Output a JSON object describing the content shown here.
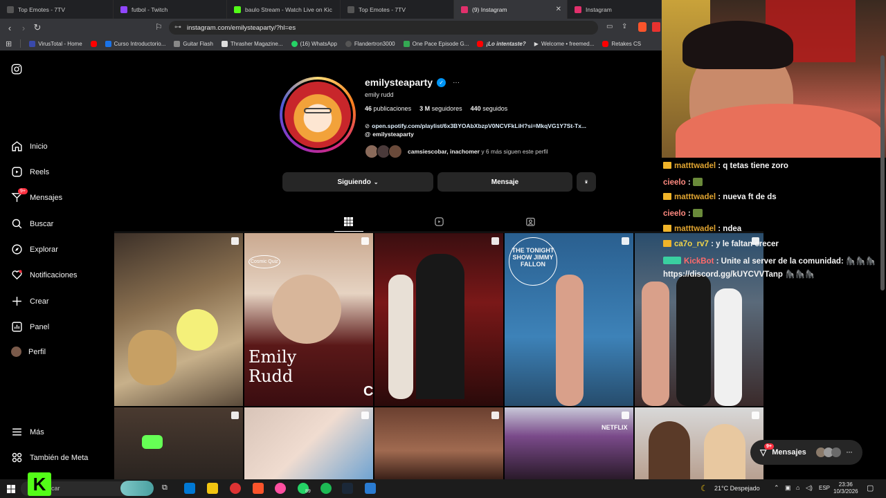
{
  "tabs": [
    {
      "label": "Top Emotes - 7TV",
      "color": "#29b6f6"
    },
    {
      "label": "futbol - Twitch",
      "color": "#9146ff"
    },
    {
      "label": "baulo Stream - Watch Live on Kic",
      "color": "#53fc18"
    },
    {
      "label": "Top Emotes - 7TV",
      "color": "#29b6f6"
    },
    {
      "label": "(9) Instagram",
      "color": "#e1306c"
    },
    {
      "label": "Instagram",
      "color": "#e1306c"
    }
  ],
  "address": {
    "url": "instagram.com/emilysteaparty/?hl=es"
  },
  "bookmarks": [
    {
      "label": "VirusTotal - Home",
      "color": "#3949ab"
    },
    {
      "label": "",
      "color": "#ff0000"
    },
    {
      "label": "Curso Introductorio...",
      "color": "#1a73e8"
    },
    {
      "label": "Guitar Flash",
      "color": "#888"
    },
    {
      "label": "Thrasher Magazine...",
      "color": "#ddd"
    },
    {
      "label": "(16) WhatsApp",
      "color": "#25d366"
    },
    {
      "label": "Flandertron3000",
      "color": "#555"
    },
    {
      "label": "One Pace Episode G...",
      "color": "#34a853"
    },
    {
      "label": "¡Lo intentaste?",
      "color": "#ff0000"
    },
    {
      "label": "Welcome • freemed...",
      "color": "#000"
    },
    {
      "label": "Retakes CS",
      "color": "#ff0000"
    }
  ],
  "sidebar": {
    "items": [
      {
        "label": "Inicio",
        "icon": "home-icon"
      },
      {
        "label": "Reels",
        "icon": "reels-icon"
      },
      {
        "label": "Mensajes",
        "icon": "messages-icon",
        "badge": "9+"
      },
      {
        "label": "Buscar",
        "icon": "search-icon"
      },
      {
        "label": "Explorar",
        "icon": "explore-icon"
      },
      {
        "label": "Notificaciones",
        "icon": "heart-icon"
      },
      {
        "label": "Crear",
        "icon": "plus-icon"
      },
      {
        "label": "Panel",
        "icon": "panel-icon"
      },
      {
        "label": "Perfil",
        "icon": "profile-icon"
      }
    ],
    "more": "Más",
    "meta": "También de Meta"
  },
  "profile": {
    "username": "emilysteaparty",
    "name": "emily rudd",
    "posts_count": "46",
    "posts_label": "publicaciones",
    "followers_count": "3 M",
    "followers_label": "seguidores",
    "following_count": "440",
    "following_label": "seguidos",
    "link": "open.spotify.com/playlist/6x3BYOAbXbzpV0NCVFkLiH?si=MkqVG1Y7St-Tx...",
    "threads": "emilysteaparty",
    "followed_by_names": "camsiescobar, inachomer",
    "followed_by_rest": " y 6 más siguen este perfil",
    "following_btn": "Siguiendo",
    "message_btn": "Mensaje"
  },
  "posts": [
    {
      "colors": [
        "#6a5a4a",
        "#c9a97a"
      ]
    },
    {
      "colors": [
        "#6b2a2a",
        "#d9c2b0"
      ],
      "overlay": "Emily\nRudd"
    },
    {
      "colors": [
        "#2a1010",
        "#7a1818"
      ]
    },
    {
      "colors": [
        "#2f6c9c",
        "#4a90c2"
      ]
    },
    {
      "colors": [
        "#2c4f6e",
        "#8a6a5a"
      ]
    },
    {
      "colors": [
        "#5a4030",
        "#2a2a2a"
      ]
    },
    {
      "colors": [
        "#5d8db7",
        "#e9cdb6"
      ]
    },
    {
      "colors": [
        "#6b4030",
        "#3a2018"
      ]
    },
    {
      "colors": [
        "#6a3a7a",
        "#c48aa8"
      ]
    },
    {
      "colors": [
        "#c8c8c8",
        "#3a2a20"
      ]
    }
  ],
  "post_overlays": {
    "post2": "Emily\nRudd",
    "cosmo": "Cosmic Quiz",
    "c_letter": "C",
    "tonight": "THE TONIGHT SHOW JIMMY FALLON",
    "netflix": "NETFLIX"
  },
  "chat": [
    {
      "user": "matttwadel",
      "color": "#e0a431",
      "crown": true,
      "text": ": q tetas tiene zoro"
    },
    {
      "user": "cieelo",
      "color": "#ff8a80",
      "crown": false,
      "text": ":"
    },
    {
      "user": "matttwadel",
      "color": "#e0a431",
      "crown": true,
      "text": ": nueva ft de ds"
    },
    {
      "user": "cieelo",
      "color": "#ff8a80",
      "crown": false,
      "text": ":"
    },
    {
      "user": "matttwadel",
      "color": "#e0a431",
      "crown": true,
      "text": ": ndea"
    },
    {
      "user": "ca7o_rv7",
      "color": "#f3d64a",
      "crown": true,
      "text": ": y le faltan crecer"
    },
    {
      "user": "KickBot",
      "color": "#ff6b6b",
      "crown": false,
      "text": ": Unite al server de la comunidad:"
    },
    {
      "user": "",
      "color": "#fff",
      "crown": false,
      "text": "https://discord.gg/kUYCVVTanp"
    }
  ],
  "msgpill": {
    "label": "Mensajes",
    "badge": "9+"
  },
  "taskbar": {
    "search": "car",
    "weather": "21°C  Despejado",
    "lang": "ESP",
    "time": "23:36",
    "date": "10/3/2026",
    "badge": "89"
  }
}
